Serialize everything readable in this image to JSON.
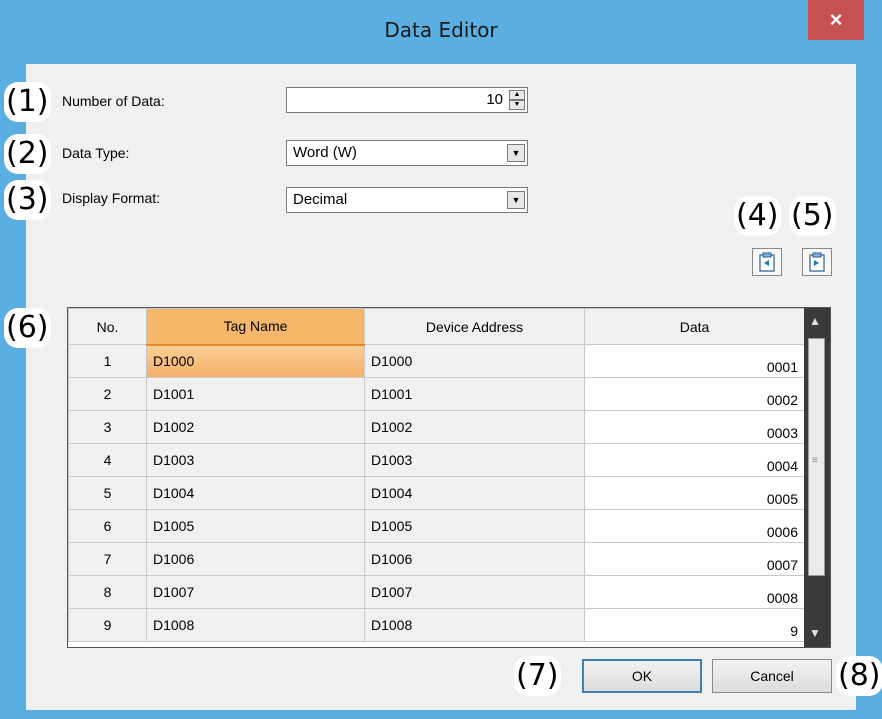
{
  "window": {
    "title": "Data Editor",
    "close_glyph": "×"
  },
  "callouts": [
    "(1)",
    "(2)",
    "(3)",
    "(4)",
    "(5)",
    "(6)",
    "(7)",
    "(8)"
  ],
  "form": {
    "number_of_data": {
      "label": "Number of Data:",
      "value": "10"
    },
    "data_type": {
      "label": "Data Type:",
      "value": "Word (W)"
    },
    "display_format": {
      "label": "Display Format:",
      "value": "Decimal"
    }
  },
  "toolbar": {
    "import_icon": "import-clipboard-icon",
    "export_icon": "export-clipboard-icon"
  },
  "grid": {
    "columns": [
      "No.",
      "Tag Name",
      "Device Address",
      "Data"
    ],
    "rows": [
      {
        "no": "1",
        "tag": "D1000",
        "addr": "D1000",
        "data": "0001"
      },
      {
        "no": "2",
        "tag": "D1001",
        "addr": "D1001",
        "data": "0002"
      },
      {
        "no": "3",
        "tag": "D1002",
        "addr": "D1002",
        "data": "0003"
      },
      {
        "no": "4",
        "tag": "D1003",
        "addr": "D1003",
        "data": "0004"
      },
      {
        "no": "5",
        "tag": "D1004",
        "addr": "D1004",
        "data": "0005"
      },
      {
        "no": "6",
        "tag": "D1005",
        "addr": "D1005",
        "data": "0006"
      },
      {
        "no": "7",
        "tag": "D1006",
        "addr": "D1006",
        "data": "0007"
      },
      {
        "no": "8",
        "tag": "D1007",
        "addr": "D1007",
        "data": "0008"
      },
      {
        "no": "9",
        "tag": "D1008",
        "addr": "D1008",
        "data": "9"
      }
    ]
  },
  "buttons": {
    "ok": "OK",
    "cancel": "Cancel"
  }
}
